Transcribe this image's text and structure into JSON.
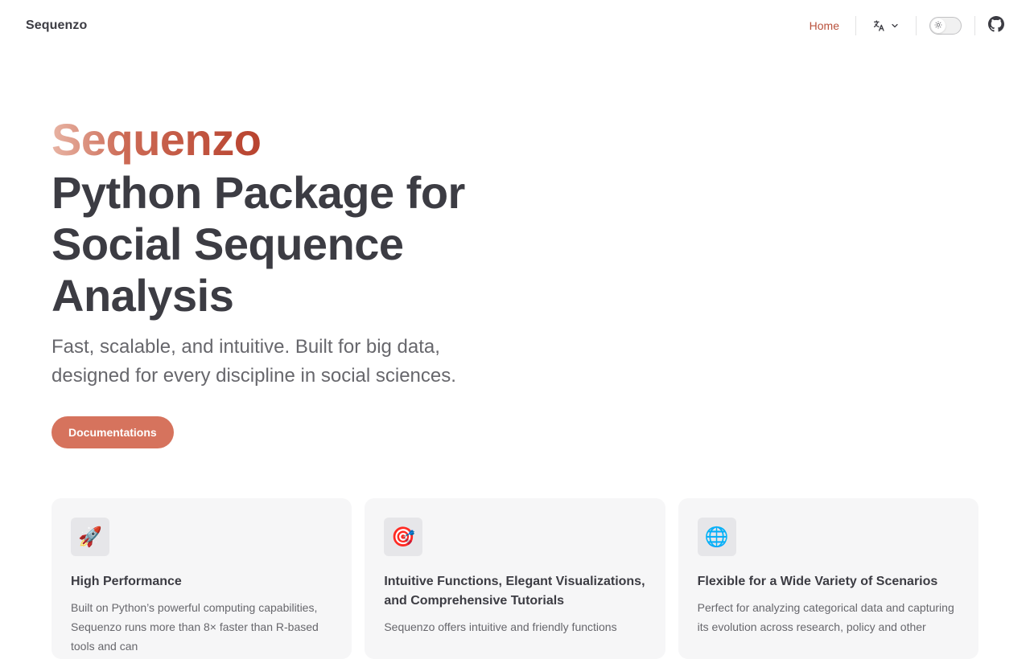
{
  "nav": {
    "brand": "Sequenzo",
    "home_label": "Home",
    "language_icon": "translate-icon",
    "theme_toggle_icon": "sun-icon",
    "github_icon": "github-icon",
    "active_color": "#b9513c"
  },
  "hero": {
    "name": "Sequenzo",
    "text": "Python Package for Social Sequence Analysis",
    "tagline": "Fast, scalable, and intuitive. Built for big data, designed for every discipline in social sciences.",
    "cta_label": "Documentations",
    "cta_color": "#d6735d"
  },
  "features": [
    {
      "icon": "🚀",
      "icon_name": "rocket-icon",
      "title": "High Performance",
      "desc": "Built on Python’s powerful computing capabilities, Sequenzo runs more than 8× faster than R-based tools and can"
    },
    {
      "icon": "🎯",
      "icon_name": "target-icon",
      "title": "Intuitive Functions, Elegant Visualizations, and Comprehensive Tutorials",
      "desc": "Sequenzo offers intuitive and friendly functions"
    },
    {
      "icon": "🌐",
      "icon_name": "globe-icon",
      "title": "Flexible for a Wide Variety of Scenarios",
      "desc": "Perfect for analyzing categorical data and capturing its evolution across research, policy and other"
    }
  ]
}
